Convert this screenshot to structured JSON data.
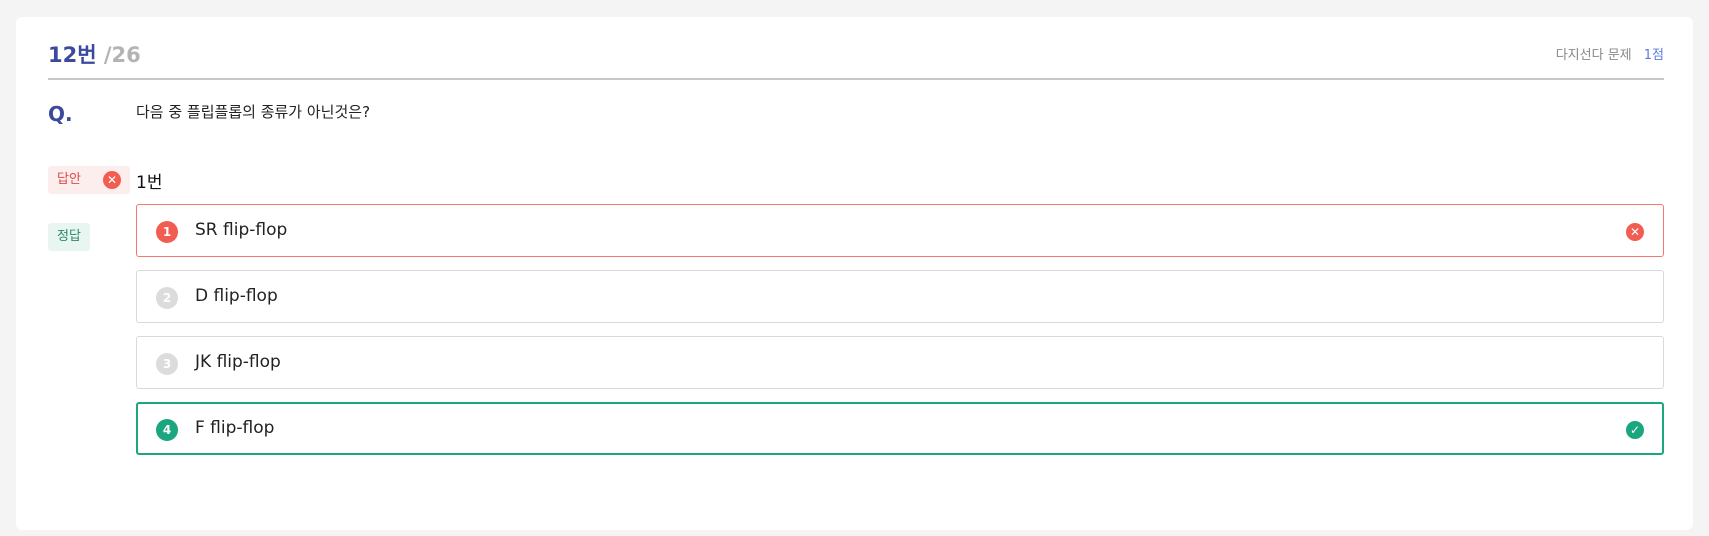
{
  "question": {
    "number": "12번",
    "total": "/26",
    "type_label": "다지선다 문제",
    "points": "1점",
    "q_label": "Q.",
    "text": "다음 중 플립플롭의 종류가 아닌것은?"
  },
  "answer": {
    "tag_label": "답안",
    "value": "1번",
    "status": "incorrect"
  },
  "correct": {
    "tag_label": "정답"
  },
  "options": [
    {
      "num": "1",
      "label": "SR flip-flop",
      "state": "selected-wrong",
      "num_color": "#f25d52",
      "status_icon": "x-circle-icon"
    },
    {
      "num": "2",
      "label": "D flip-flop",
      "state": "neutral",
      "num_color": "#dcdcdc"
    },
    {
      "num": "3",
      "label": "JK flip-flop",
      "state": "neutral",
      "num_color": "#dcdcdc"
    },
    {
      "num": "4",
      "label": "F flip-flop",
      "state": "correct",
      "num_color": "#1aa67f",
      "status_icon": "check-circle-icon"
    }
  ],
  "colors": {
    "accent": "#3b4a9c",
    "wrong": "#f25d52",
    "correct": "#1aa67f",
    "points": "#5b7be0"
  }
}
